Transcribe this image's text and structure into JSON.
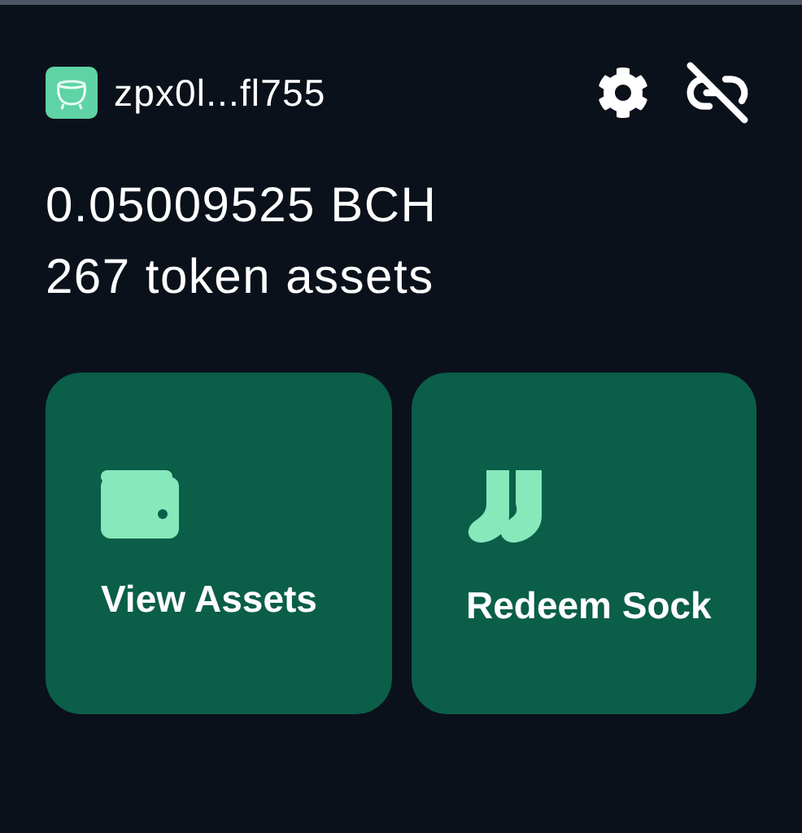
{
  "header": {
    "address": "zpx0l...fl755"
  },
  "balance": {
    "amount": "0.05009525 BCH",
    "tokens": "267 token assets"
  },
  "actions": [
    {
      "label": "View Assets"
    },
    {
      "label": "Redeem Sock"
    }
  ]
}
